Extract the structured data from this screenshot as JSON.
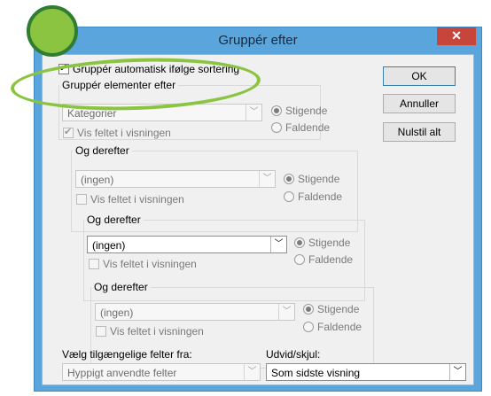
{
  "dialog": {
    "title": "Gruppér efter",
    "close_glyph": "✕",
    "auto_group_label": "Gruppér automatisk ifølge sortering",
    "auto_group_checked": true
  },
  "groups": [
    {
      "label": "Gruppér elementer efter",
      "value": "Kategorier",
      "show_field_label": "Vis feltet i visningen",
      "show_field_checked": true,
      "ascending_label": "Stigende",
      "descending_label": "Faldende",
      "selected": "ascending"
    },
    {
      "label": "Og derefter",
      "value": "(ingen)",
      "show_field_label": "Vis feltet i visningen",
      "show_field_checked": false,
      "ascending_label": "Stigende",
      "descending_label": "Faldende",
      "selected": "ascending"
    },
    {
      "label": "Og derefter",
      "value": "(ingen)",
      "show_field_label": "Vis feltet i visningen",
      "show_field_checked": false,
      "ascending_label": "Stigende",
      "descending_label": "Faldende",
      "selected": "ascending"
    },
    {
      "label": "Og derefter",
      "value": "(ingen)",
      "show_field_label": "Vis feltet i visningen",
      "show_field_checked": false,
      "ascending_label": "Stigende",
      "descending_label": "Faldende",
      "selected": "ascending"
    }
  ],
  "buttons": {
    "ok": "OK",
    "cancel": "Annuller",
    "reset": "Nulstil alt"
  },
  "footer": {
    "fields_from_label": "Vælg tilgængelige felter fra:",
    "fields_from_value": "Hyppigt anvendte felter",
    "expand_label": "Udvid/skjul:",
    "expand_value": "Som sidste visning"
  },
  "annotation": {
    "highlight_color": "#8ac441",
    "circle_color": "#2e7d32"
  },
  "icons": {
    "dropdown": "chevron-down-icon",
    "close": "close-icon"
  }
}
